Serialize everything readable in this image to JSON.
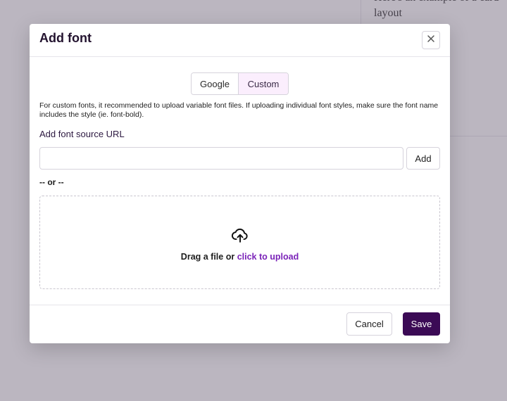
{
  "background": {
    "card_text": "Here's an example of a card layout"
  },
  "modal": {
    "title": "Add font",
    "close_icon": "close-icon",
    "tabs": [
      {
        "label": "Google",
        "selected": false
      },
      {
        "label": "Custom",
        "selected": true
      }
    ],
    "help_text": "For custom fonts, it recommended to upload variable font files. If uploading individual font styles, make sure the font name includes the style (ie. font-bold).",
    "url_label": "Add font source URL",
    "url_input": {
      "value": "",
      "placeholder": ""
    },
    "add_label": "Add",
    "or_text": "-- or --",
    "dropzone": {
      "icon": "cloud-upload-icon",
      "text": "Drag a file or ",
      "link": "click to upload"
    },
    "cancel_label": "Cancel",
    "save_label": "Save"
  },
  "colors": {
    "primary": "#3b0a55",
    "link": "#7a22b8",
    "selected_tab_bg": "#fbeefd",
    "overlay": "#70667c"
  }
}
